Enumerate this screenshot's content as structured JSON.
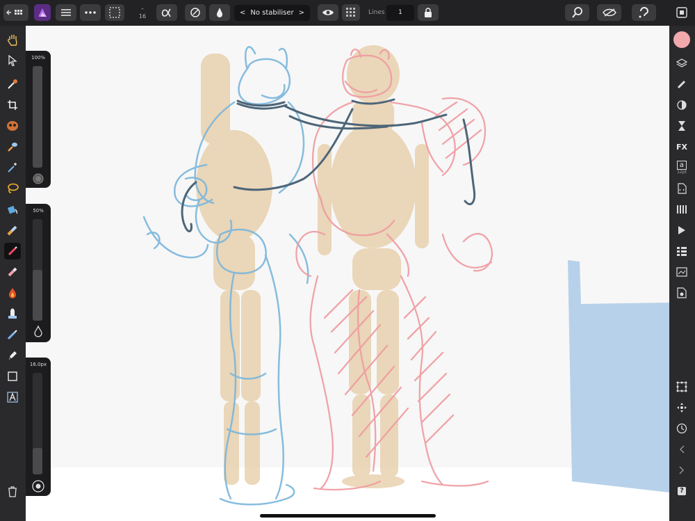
{
  "toolbar": {
    "brush_size_readout": "16",
    "stabiliser_label": "No stabiliser",
    "stabiliser_prev": "<",
    "stabiliser_next": ">",
    "lines_label": "Lines",
    "lines_value": "1",
    "icons": [
      "back-grid-icon",
      "affinity-logo-icon",
      "menu-icon",
      "more-icon",
      "selection-icon",
      "minus-icon",
      "alpha-icon",
      "pressure-icon",
      "flow-icon",
      "eye-icon",
      "texture-icon",
      "lock-icon",
      "zoom-icon",
      "quick-mask-icon",
      "assistant-icon",
      "snapshot-icon"
    ]
  },
  "sliders": {
    "opacity": {
      "label": "100%",
      "fraction": 1.0
    },
    "flow": {
      "label": "50%",
      "fraction": 0.5
    },
    "width": {
      "label": "16.0px",
      "fraction": 0.26
    }
  },
  "left_tools": [
    "hand-icon",
    "move-icon",
    "color-picker-icon",
    "crop-icon",
    "selection-brush-icon",
    "flood-select-icon",
    "magic-wand-icon",
    "freehand-selection-icon",
    "flood-fill-icon",
    "gradient-icon",
    "paint-brush-icon",
    "erase-brush-icon",
    "burn-icon",
    "clone-icon",
    "healing-icon",
    "pen-icon",
    "rectangle-icon",
    "artistic-text-icon",
    "trash-icon"
  ],
  "right_tools": [
    "color-swatch",
    "layers-icon",
    "brushes-icon",
    "adjustments-icon",
    "history-icon",
    "fx-icon",
    "character-icon",
    "character-size",
    "source-icon",
    "swatches-icon",
    "play-icon",
    "channels-icon",
    "navigator-icon",
    "assets-icon",
    "snapping-icon",
    "transform-icon",
    "history-clock-icon",
    "undo-icon",
    "redo-icon",
    "help-icon"
  ],
  "colors": {
    "primary_swatch": "#f2a9ae",
    "blue_sketch": "#7ab6dc",
    "pink_sketch": "#ef9ba0",
    "mannequin": "#e6cba3",
    "blue_block": "#b8d1ea"
  },
  "right_labels": {
    "fx": "FX",
    "char": "a",
    "char_size": "12pt",
    "help": "?"
  }
}
